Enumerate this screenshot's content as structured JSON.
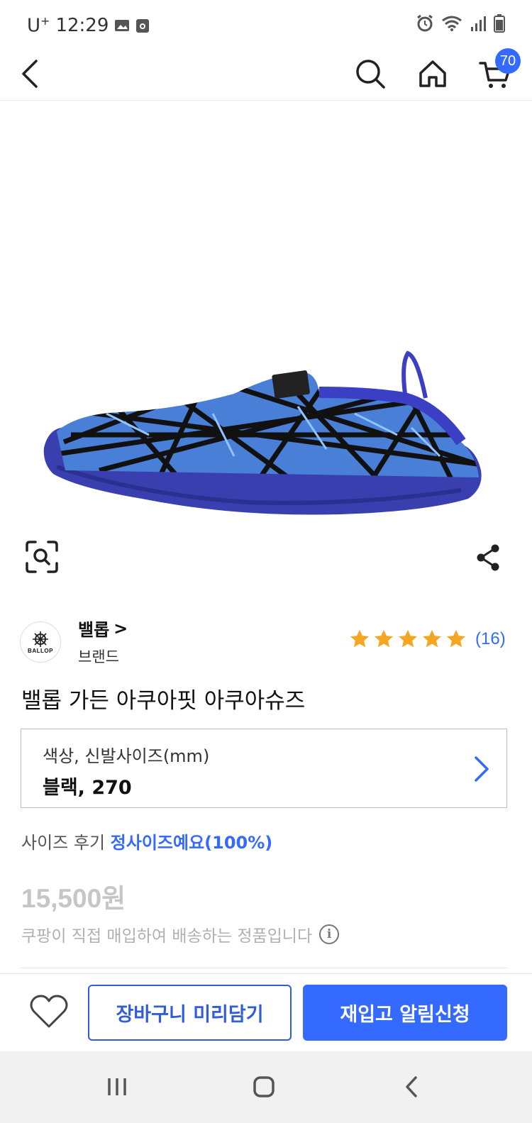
{
  "status_bar": {
    "carrier": "U",
    "carrier_sup": "+",
    "time": "12:29"
  },
  "top_nav": {
    "icons": [
      "back-arrow-icon",
      "search-icon",
      "home-icon",
      "cart-icon"
    ],
    "cart_count": "70"
  },
  "product": {
    "image_icons": [
      "lens-search-icon",
      "share-icon"
    ],
    "brand": {
      "logo_text": "BALLOP",
      "name": "밸롭",
      "chevron": ">",
      "subtitle": "브랜드"
    },
    "rating": {
      "stars": 5,
      "count": "(16)"
    },
    "title": "밸롭 가든 아쿠아핏 아쿠아슈즈",
    "option": {
      "label": "색상, 신발사이즈(mm)",
      "value": "블랙, 270"
    },
    "size_review": {
      "label": "사이즈 후기",
      "value": "정사이즈예요(100%)"
    },
    "price": "15,500원",
    "notice": "쿠팡이 직접 매입하여 배송하는 정품입니다"
  },
  "action_bar": {
    "pre_cart_label": "장바구니 미리담기",
    "restock_label": "재입고 알림신청"
  },
  "colors": {
    "accent": "#346aff",
    "price_disabled": "#c6c6c6",
    "star": "#f5a623"
  }
}
